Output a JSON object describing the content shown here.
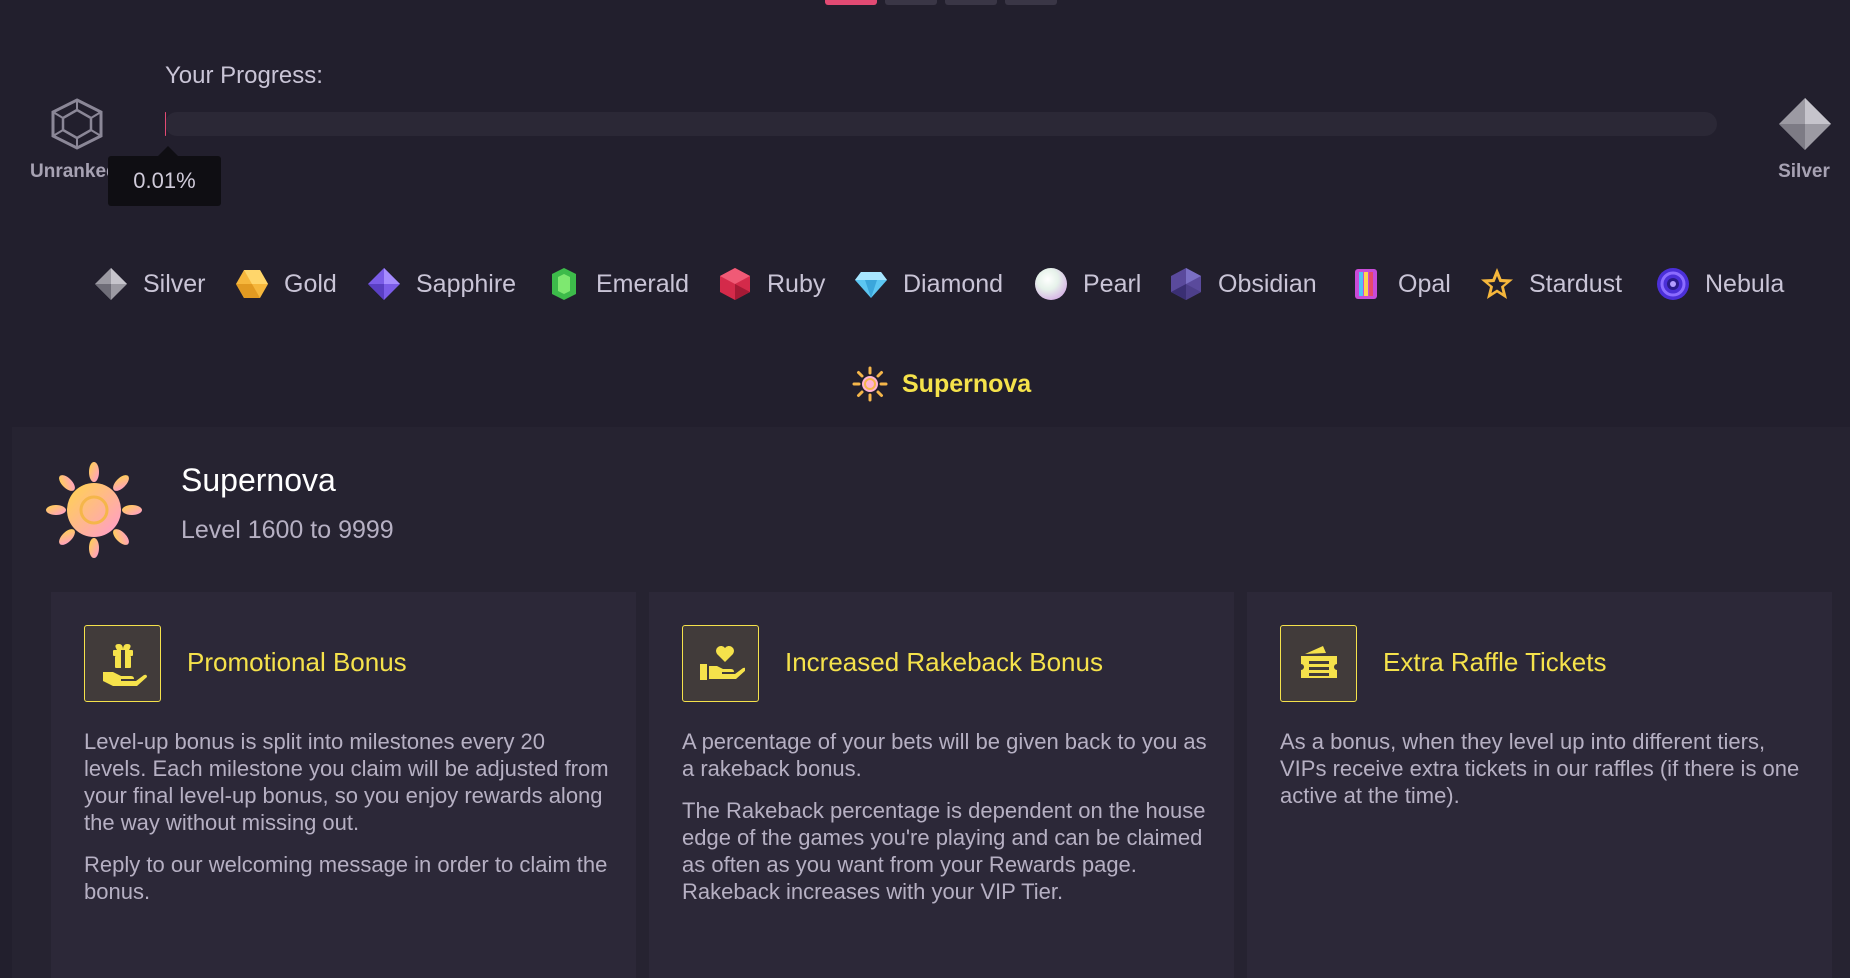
{
  "carousel": {
    "dots": 4,
    "active_index": 0
  },
  "progress": {
    "title": "Your Progress:",
    "percent_label": "0.01%",
    "fraction": 0.0001,
    "current_tier": "Unranked",
    "next_tier": "Silver"
  },
  "tiers": [
    {
      "label": "Silver",
      "icon": "silver-diamond-icon"
    },
    {
      "label": "Gold",
      "icon": "gold-hexagon-icon"
    },
    {
      "label": "Sapphire",
      "icon": "sapphire-gem-icon"
    },
    {
      "label": "Emerald",
      "icon": "emerald-gem-icon"
    },
    {
      "label": "Ruby",
      "icon": "ruby-gem-icon"
    },
    {
      "label": "Diamond",
      "icon": "diamond-gem-icon"
    },
    {
      "label": "Pearl",
      "icon": "pearl-icon"
    },
    {
      "label": "Obsidian",
      "icon": "obsidian-gem-icon"
    },
    {
      "label": "Opal",
      "icon": "opal-gem-icon"
    },
    {
      "label": "Stardust",
      "icon": "star-icon"
    },
    {
      "label": "Nebula",
      "icon": "nebula-swirl-icon"
    },
    {
      "label": "Supernova",
      "icon": "supernova-sun-icon",
      "selected": true
    }
  ],
  "detail": {
    "title": "Supernova",
    "level_range": "Level 1600 to 9999",
    "cards": [
      {
        "title": "Promotional Bonus",
        "icon": "gift-hand-icon",
        "paragraphs": [
          "Level-up bonus is split into milestones every 20 levels. Each milestone you claim will be adjusted from your final level-up bonus, so you enjoy rewards along the way without missing out.",
          "Reply to our welcoming message in order to claim the bonus."
        ]
      },
      {
        "title": "Increased Rakeback Bonus",
        "icon": "heart-hand-icon",
        "paragraphs": [
          "A percentage of your bets will be given back to you as a rakeback bonus.",
          "The Rakeback percentage is dependent on the house edge of the games you're playing and can be claimed as often as you want from your Rewards page. Rakeback increases with your VIP Tier."
        ]
      },
      {
        "title": "Extra Raffle Tickets",
        "icon": "tickets-icon",
        "paragraphs": [
          "As a bonus, when they level up into different tiers, VIPs receive extra tickets in our raffles (if there is one active at the time)."
        ]
      }
    ]
  },
  "colors": {
    "background": "#221f2d",
    "accent_yellow": "#f5e24b",
    "progress_accent": "#e24a73"
  }
}
